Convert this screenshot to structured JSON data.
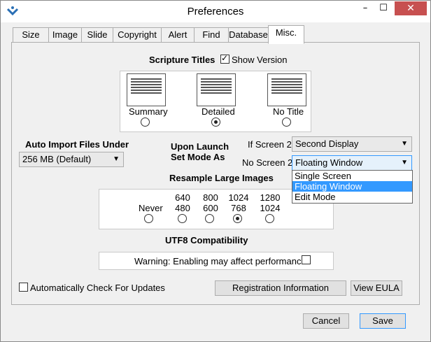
{
  "window": {
    "title": "Preferences",
    "minimize": "–",
    "maximize": "☐",
    "close": "✕"
  },
  "tabs": [
    {
      "label": "Size"
    },
    {
      "label": "Image"
    },
    {
      "label": "Slide"
    },
    {
      "label": "Copyright"
    },
    {
      "label": "Alert"
    },
    {
      "label": "Find"
    },
    {
      "label": "Database"
    },
    {
      "label": "Misc."
    }
  ],
  "active_tab": "Misc.",
  "scripture_titles": {
    "heading": "Scripture Titles",
    "show_version_label": "Show Version",
    "show_version_checked": true,
    "check_glyph": "✓",
    "options": [
      {
        "label": "Summary",
        "selected": false
      },
      {
        "label": "Detailed",
        "selected": true
      },
      {
        "label": "No Title",
        "selected": false
      }
    ]
  },
  "auto_import": {
    "heading": "Auto Import Files Under",
    "value": "256 MB (Default)"
  },
  "upon_launch": {
    "heading_line1": "Upon Launch",
    "heading_line2": "Set Mode As",
    "if_screen2_label": "If Screen 2:",
    "if_screen2_value": "Second Display",
    "no_screen2_label": "No Screen 2:",
    "no_screen2_value": "Floating Window",
    "dropdown_options": [
      "Single Screen",
      "Floating Window",
      "Edit Mode"
    ],
    "highlighted_option": "Floating Window"
  },
  "resample": {
    "heading": "Resample Large Images",
    "never_label": "Never",
    "options": [
      {
        "w": "640",
        "h": "480",
        "selected": false
      },
      {
        "w": "800",
        "h": "600",
        "selected": false
      },
      {
        "w": "1024",
        "h": "768",
        "selected": true
      },
      {
        "w": "1280",
        "h": "1024",
        "selected": false
      }
    ],
    "never_selected": false
  },
  "utf8": {
    "heading": "UTF8 Compatibility",
    "warning": "Warning: Enabling may affect performance",
    "checked": false
  },
  "auto_update": {
    "label": "Automatically Check For Updates",
    "checked": false
  },
  "buttons": {
    "registration": "Registration Information",
    "view_eula": "View EULA",
    "cancel": "Cancel",
    "save": "Save"
  },
  "arrow_glyph": "▼",
  "colors": {
    "accent": "#3399ff",
    "close_button": "#c75050"
  }
}
